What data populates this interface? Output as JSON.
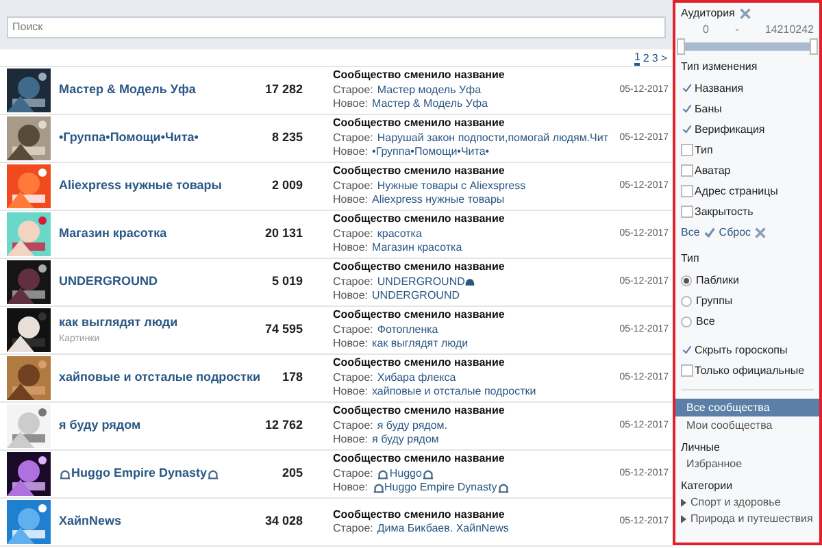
{
  "search": {
    "placeholder": "Поиск"
  },
  "pagination": [
    {
      "label": "1",
      "selected": true
    },
    {
      "label": "2",
      "selected": false
    },
    {
      "label": "3",
      "selected": false
    },
    {
      "label": ">",
      "selected": false
    }
  ],
  "rows": [
    {
      "name": "Мастер & Модель Уфа",
      "count": "17 282",
      "event": "Сообщество сменило название",
      "old_label": "Старое:",
      "old": {
        "text": "Мастер модель Уфа"
      },
      "new_label": "Новое:",
      "new": {
        "text": "Мастер & Модель Уфа"
      },
      "date": "05-12-2017"
    },
    {
      "name": "•Группа•Помощи•Чита•",
      "count": "8 235",
      "event": "Сообщество сменило название",
      "old_label": "Старое:",
      "old": {
        "text": "Нарушай закон подпости,помогай людям.Чит"
      },
      "new_label": "Новое:",
      "new": {
        "text": "•Группа•Помощи•Чита•"
      },
      "date": "05-12-2017"
    },
    {
      "name": "Aliexpress нужные товары",
      "count": "2 009",
      "event": "Сообщество сменило название",
      "old_label": "Старое:",
      "old": {
        "text": "Нужные товары с Aliexspress"
      },
      "new_label": "Новое:",
      "new": {
        "text": "Aliexpress нужные товары"
      },
      "date": "05-12-2017"
    },
    {
      "name": "Магазин красотка",
      "count": "20 131",
      "event": "Сообщество сменило название",
      "old_label": "Старое:",
      "old": {
        "text": "красотка"
      },
      "new_label": "Новое:",
      "new": {
        "text": "Магазин красотка"
      },
      "date": "05-12-2017"
    },
    {
      "name": "UNDERGROUND",
      "count": "5 019",
      "event": "Сообщество сменило название",
      "old_label": "Старое:",
      "old": {
        "text": "UNDERGROUND",
        "icon_after": true
      },
      "new_label": "Новое:",
      "new": {
        "text": "UNDERGROUND"
      },
      "date": "05-12-2017"
    },
    {
      "name": "как выглядят люди",
      "subtitle": "Картинки",
      "count": "74 595",
      "event": "Сообщество сменило название",
      "old_label": "Старое:",
      "old": {
        "text": "Фотопленка"
      },
      "new_label": "Новое:",
      "new": {
        "text": "как выглядят люди"
      },
      "date": "05-12-2017"
    },
    {
      "name": "хайповые и отсталые подростки",
      "count": "178",
      "event": "Сообщество сменило название",
      "old_label": "Старое:",
      "old": {
        "text": "Хибара флекса"
      },
      "new_label": "Новое:",
      "new": {
        "text": "хайповые и отсталые подростки"
      },
      "date": "05-12-2017"
    },
    {
      "name": "я буду рядом",
      "count": "12 762",
      "event": "Сообщество сменило название",
      "old_label": "Старое:",
      "old": {
        "text": "я буду рядом."
      },
      "new_label": "Новое:",
      "new": {
        "text": "я буду рядом"
      },
      "date": "05-12-2017"
    },
    {
      "name": "Huggo Empire Dynasty",
      "name_icons": true,
      "count": "205",
      "event": "Сообщество сменило название",
      "old_label": "Старое:",
      "old": {
        "text": "Huggo",
        "icons_around": true
      },
      "new_label": "Новое:",
      "new": {
        "text": "Huggo Empire Dynasty",
        "icons_around": true
      },
      "date": "05-12-2017"
    },
    {
      "name": "ХайпNews",
      "count": "34 028",
      "event": "Сообщество сменило название",
      "old_label": "Старое:",
      "old": {
        "text": "Дима Бикбаев. ХайпNews"
      },
      "date": "05-12-2017"
    }
  ],
  "filters": {
    "audience": {
      "title": "Аудитория",
      "min": "0",
      "dash": "-",
      "max": "14210242"
    },
    "change_type": {
      "title": "Тип изменения",
      "options": [
        {
          "label": "Названия",
          "checked": true
        },
        {
          "label": "Баны",
          "checked": true
        },
        {
          "label": "Верификация",
          "checked": true
        },
        {
          "label": "Тип",
          "checked": false
        },
        {
          "label": "Аватар",
          "checked": false
        },
        {
          "label": "Адрес страницы",
          "checked": false
        },
        {
          "label": "Закрытость",
          "checked": false
        }
      ],
      "all_link": "Все",
      "reset_link": "Сброс"
    },
    "type": {
      "title": "Тип",
      "options": [
        {
          "label": "Паблики",
          "selected": true
        },
        {
          "label": "Группы",
          "selected": false
        },
        {
          "label": "Все",
          "selected": false
        }
      ]
    },
    "extra": [
      {
        "label": "Скрыть гороскопы",
        "checked": true
      },
      {
        "label": "Только официальные",
        "checked": false
      }
    ]
  },
  "nav": [
    {
      "label": "Все сообщества",
      "selected": true
    },
    {
      "label": "Мои сообщества",
      "selected": false
    }
  ],
  "personal": {
    "title": "Личные",
    "items": [
      "Избранное"
    ]
  },
  "categories": {
    "title": "Категории",
    "items": [
      "Спорт и здоровье",
      "Природа и путешествия"
    ]
  }
}
